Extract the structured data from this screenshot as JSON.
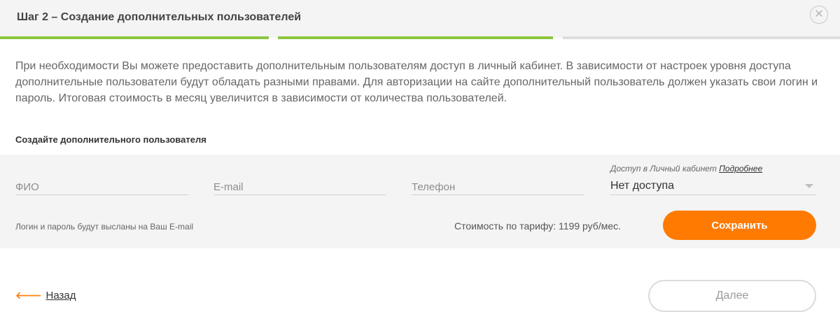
{
  "header": {
    "title": "Шаг 2 – Создание дополнительных пользователей",
    "close_symbol": "✕",
    "close_icon": "close-icon"
  },
  "progress": {
    "steps": [
      {
        "state": "done",
        "color": "#8dc63f"
      },
      {
        "state": "current",
        "color": "#8dc63f"
      },
      {
        "state": "pending",
        "color": "#dddddd"
      }
    ]
  },
  "description": "При необходимости Вы можете предоставить дополнительным пользователям доступ в личный кабинет. В зависимости от настроек уровня доступа дополнительные пользователи будут обладать разными правами. Для авторизации на сайте дополнительный пользователь должен указать свои логин и пароль. Итоговая стоимость в месяц увеличится в зависимости от количества пользователей.",
  "form": {
    "title": "Создайте дополнительного пользователя",
    "fio_placeholder": "ФИО",
    "email_placeholder": "E-mail",
    "phone_placeholder": "Телефон",
    "access_label": "Доступ в Личный кабинет",
    "access_more_link": "Подробнее",
    "access_value": "Нет доступа",
    "credentials_note": "Логин и пароль будут высланы на Ваш E-mail",
    "price_text": "Стоимость по тарифу: 1199 руб/мес.",
    "save_label": "Сохранить"
  },
  "footer": {
    "back_label": "Назад",
    "back_arrow": "🡐",
    "back_icon": "arrow-left-icon",
    "next_label": "Далее"
  },
  "colors": {
    "accent_orange": "#ff7a00",
    "progress_green": "#8dc63f",
    "progress_gray": "#dddddd",
    "panel_bg": "#f4f4f4"
  }
}
